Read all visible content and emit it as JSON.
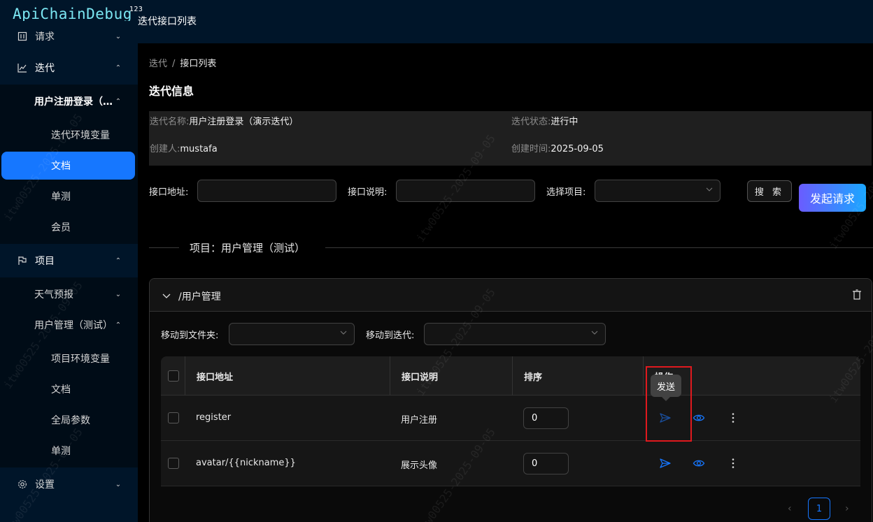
{
  "app": {
    "logo": "ApiChainDebug",
    "logo_sup": "123",
    "page_title": "迭代接口列表"
  },
  "sidebar": {
    "items": [
      {
        "label": "请求",
        "icon": "request-icon",
        "arrow": "down"
      },
      {
        "label": "迭代",
        "icon": "chart-line-icon",
        "arrow": "up"
      },
      {
        "label": "用户注册登录（演示迭代）",
        "arrow": "up"
      },
      {
        "label": "迭代环境变量"
      },
      {
        "label": "文档"
      },
      {
        "label": "单测"
      },
      {
        "label": "会员"
      },
      {
        "label": "项目",
        "icon": "flag-icon",
        "arrow": "up"
      },
      {
        "label": "天气预报",
        "arrow": "down"
      },
      {
        "label": "用户管理（测试）",
        "arrow": "up"
      },
      {
        "label": "项目环境变量"
      },
      {
        "label": "文档"
      },
      {
        "label": "全局参数"
      },
      {
        "label": "单测"
      },
      {
        "label": "设置",
        "icon": "gear-icon",
        "arrow": "down"
      }
    ]
  },
  "breadcrumb": {
    "parent": "迭代",
    "separator": "/",
    "current": "接口列表"
  },
  "section_title": "迭代信息",
  "info": {
    "name_label": "迭代名称:",
    "name_value": "用户注册登录（演示迭代）",
    "status_label": "迭代状态:",
    "status_value": "进行中",
    "creator_label": "创建人:",
    "creator_value": "mustafa",
    "created_label": "创建时间:",
    "created_value": "2025-09-05"
  },
  "filters": {
    "url_label": "接口地址:",
    "url_value": "",
    "desc_label": "接口说明:",
    "desc_value": "",
    "project_label": "选择项目:",
    "project_value": "",
    "search_button": "搜 索",
    "launch_button": "发起请求"
  },
  "project_divider": "项目：用户管理（测试）",
  "folder": {
    "title": "/用户管理",
    "move_folder_label": "移动到文件夹:",
    "move_iter_label": "移动到迭代:"
  },
  "table": {
    "columns": [
      "接口地址",
      "接口说明",
      "排序",
      "操作"
    ],
    "rows": [
      {
        "url": "register",
        "desc": "用户注册",
        "order": "0"
      },
      {
        "url": "avatar/{{nickname}}",
        "desc": "展示头像",
        "order": "0"
      }
    ]
  },
  "tooltip": "发送",
  "pagination": {
    "current": "1"
  },
  "watermark": "itw00525-2025-09-05",
  "colors": {
    "primary": "#1677ff",
    "sidebar_bg": "#001529",
    "highlight": "#e0191e",
    "logo": "#7be6f2"
  }
}
